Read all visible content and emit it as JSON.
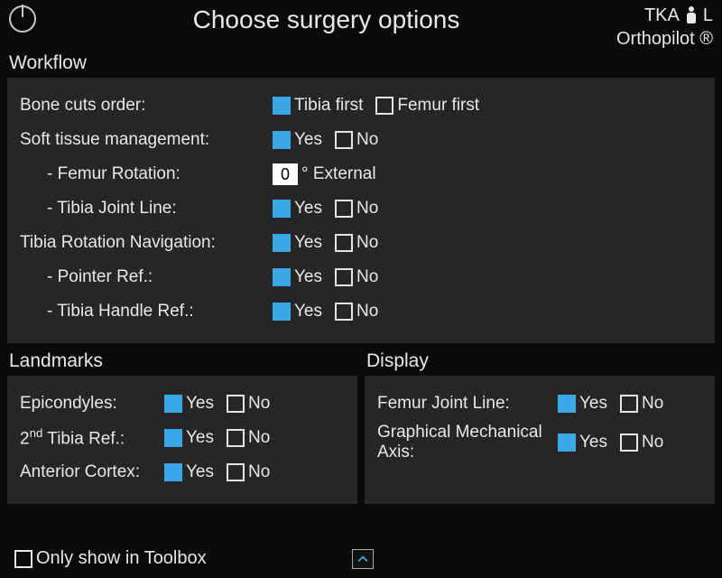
{
  "header": {
    "title": "Choose surgery options",
    "procedure": "TKA",
    "side": "L",
    "brand": "Orthopilot ®"
  },
  "workflow": {
    "section": "Workflow",
    "bone_cuts_label": "Bone cuts order:",
    "bone_cuts_opt1": "Tibia first",
    "bone_cuts_opt2": "Femur first",
    "soft_tissue_label": "Soft tissue management:",
    "femur_rot_label": "- Femur Rotation:",
    "femur_rot_value": "0",
    "femur_rot_suffix": "° External",
    "tibia_jl_label": "- Tibia Joint Line:",
    "tibia_rot_nav_label": "Tibia Rotation Navigation:",
    "pointer_ref_label": "- Pointer Ref.:",
    "tibia_handle_label": "- Tibia Handle Ref.:"
  },
  "landmarks": {
    "section": "Landmarks",
    "epicondyles": "Epicondyles:",
    "second_tibia_prefix": "2",
    "second_tibia_suffix": " Tibia Ref.:",
    "anterior_cortex": "Anterior Cortex:"
  },
  "display": {
    "section": "Display",
    "femur_jl": "Femur Joint Line:",
    "gma": "Graphical Mechanical Axis:"
  },
  "common": {
    "yes": "Yes",
    "no": "No"
  },
  "footer": {
    "toolbox": "Only show in Toolbox"
  }
}
